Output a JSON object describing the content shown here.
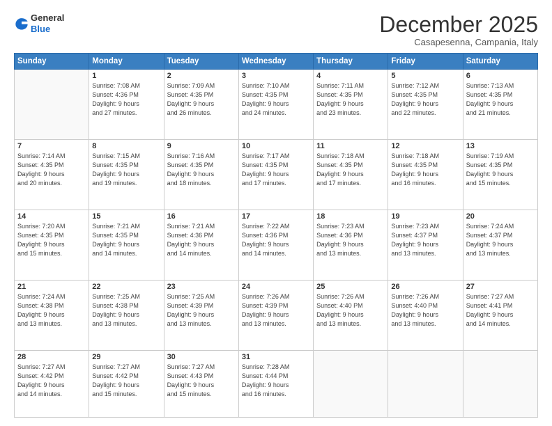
{
  "header": {
    "logo_general": "General",
    "logo_blue": "Blue",
    "month_title": "December 2025",
    "location": "Casapesenna, Campania, Italy"
  },
  "days_of_week": [
    "Sunday",
    "Monday",
    "Tuesday",
    "Wednesday",
    "Thursday",
    "Friday",
    "Saturday"
  ],
  "weeks": [
    [
      {
        "day": "",
        "info": ""
      },
      {
        "day": "1",
        "info": "Sunrise: 7:08 AM\nSunset: 4:36 PM\nDaylight: 9 hours\nand 27 minutes."
      },
      {
        "day": "2",
        "info": "Sunrise: 7:09 AM\nSunset: 4:35 PM\nDaylight: 9 hours\nand 26 minutes."
      },
      {
        "day": "3",
        "info": "Sunrise: 7:10 AM\nSunset: 4:35 PM\nDaylight: 9 hours\nand 24 minutes."
      },
      {
        "day": "4",
        "info": "Sunrise: 7:11 AM\nSunset: 4:35 PM\nDaylight: 9 hours\nand 23 minutes."
      },
      {
        "day": "5",
        "info": "Sunrise: 7:12 AM\nSunset: 4:35 PM\nDaylight: 9 hours\nand 22 minutes."
      },
      {
        "day": "6",
        "info": "Sunrise: 7:13 AM\nSunset: 4:35 PM\nDaylight: 9 hours\nand 21 minutes."
      }
    ],
    [
      {
        "day": "7",
        "info": "Sunrise: 7:14 AM\nSunset: 4:35 PM\nDaylight: 9 hours\nand 20 minutes."
      },
      {
        "day": "8",
        "info": "Sunrise: 7:15 AM\nSunset: 4:35 PM\nDaylight: 9 hours\nand 19 minutes."
      },
      {
        "day": "9",
        "info": "Sunrise: 7:16 AM\nSunset: 4:35 PM\nDaylight: 9 hours\nand 18 minutes."
      },
      {
        "day": "10",
        "info": "Sunrise: 7:17 AM\nSunset: 4:35 PM\nDaylight: 9 hours\nand 17 minutes."
      },
      {
        "day": "11",
        "info": "Sunrise: 7:18 AM\nSunset: 4:35 PM\nDaylight: 9 hours\nand 17 minutes."
      },
      {
        "day": "12",
        "info": "Sunrise: 7:18 AM\nSunset: 4:35 PM\nDaylight: 9 hours\nand 16 minutes."
      },
      {
        "day": "13",
        "info": "Sunrise: 7:19 AM\nSunset: 4:35 PM\nDaylight: 9 hours\nand 15 minutes."
      }
    ],
    [
      {
        "day": "14",
        "info": "Sunrise: 7:20 AM\nSunset: 4:35 PM\nDaylight: 9 hours\nand 15 minutes."
      },
      {
        "day": "15",
        "info": "Sunrise: 7:21 AM\nSunset: 4:35 PM\nDaylight: 9 hours\nand 14 minutes."
      },
      {
        "day": "16",
        "info": "Sunrise: 7:21 AM\nSunset: 4:36 PM\nDaylight: 9 hours\nand 14 minutes."
      },
      {
        "day": "17",
        "info": "Sunrise: 7:22 AM\nSunset: 4:36 PM\nDaylight: 9 hours\nand 14 minutes."
      },
      {
        "day": "18",
        "info": "Sunrise: 7:23 AM\nSunset: 4:36 PM\nDaylight: 9 hours\nand 13 minutes."
      },
      {
        "day": "19",
        "info": "Sunrise: 7:23 AM\nSunset: 4:37 PM\nDaylight: 9 hours\nand 13 minutes."
      },
      {
        "day": "20",
        "info": "Sunrise: 7:24 AM\nSunset: 4:37 PM\nDaylight: 9 hours\nand 13 minutes."
      }
    ],
    [
      {
        "day": "21",
        "info": "Sunrise: 7:24 AM\nSunset: 4:38 PM\nDaylight: 9 hours\nand 13 minutes."
      },
      {
        "day": "22",
        "info": "Sunrise: 7:25 AM\nSunset: 4:38 PM\nDaylight: 9 hours\nand 13 minutes."
      },
      {
        "day": "23",
        "info": "Sunrise: 7:25 AM\nSunset: 4:39 PM\nDaylight: 9 hours\nand 13 minutes."
      },
      {
        "day": "24",
        "info": "Sunrise: 7:26 AM\nSunset: 4:39 PM\nDaylight: 9 hours\nand 13 minutes."
      },
      {
        "day": "25",
        "info": "Sunrise: 7:26 AM\nSunset: 4:40 PM\nDaylight: 9 hours\nand 13 minutes."
      },
      {
        "day": "26",
        "info": "Sunrise: 7:26 AM\nSunset: 4:40 PM\nDaylight: 9 hours\nand 13 minutes."
      },
      {
        "day": "27",
        "info": "Sunrise: 7:27 AM\nSunset: 4:41 PM\nDaylight: 9 hours\nand 14 minutes."
      }
    ],
    [
      {
        "day": "28",
        "info": "Sunrise: 7:27 AM\nSunset: 4:42 PM\nDaylight: 9 hours\nand 14 minutes."
      },
      {
        "day": "29",
        "info": "Sunrise: 7:27 AM\nSunset: 4:42 PM\nDaylight: 9 hours\nand 15 minutes."
      },
      {
        "day": "30",
        "info": "Sunrise: 7:27 AM\nSunset: 4:43 PM\nDaylight: 9 hours\nand 15 minutes."
      },
      {
        "day": "31",
        "info": "Sunrise: 7:28 AM\nSunset: 4:44 PM\nDaylight: 9 hours\nand 16 minutes."
      },
      {
        "day": "",
        "info": ""
      },
      {
        "day": "",
        "info": ""
      },
      {
        "day": "",
        "info": ""
      }
    ]
  ]
}
